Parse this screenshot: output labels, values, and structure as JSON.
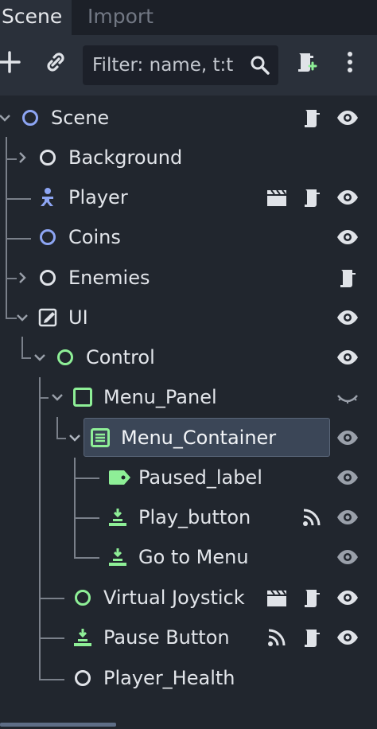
{
  "tabs": {
    "scene": "Scene",
    "import": "Import"
  },
  "toolbar": {
    "filter_placeholder": "Filter: name, t:type, g:group",
    "filter_display": "Filter: name, t:t"
  },
  "colors": {
    "node2d": "#8da5f3",
    "control": "#8eef97",
    "neutral": "#e0e3e8",
    "selection": "#3b4657",
    "background": "#21262e"
  },
  "tree": [
    {
      "label": "Scene",
      "icon": "node2d-circle-icon",
      "expanded": true,
      "script": true,
      "visible": true
    },
    {
      "label": "Background",
      "icon": "node-circle-icon",
      "expanded": false,
      "visible": null
    },
    {
      "label": "Player",
      "icon": "character-body-icon",
      "scene_instance": true,
      "script": true,
      "visible": true
    },
    {
      "label": "Coins",
      "icon": "node2d-circle-icon",
      "visible": true
    },
    {
      "label": "Enemies",
      "icon": "node-circle-icon",
      "expanded": false,
      "script": true,
      "visible": null
    },
    {
      "label": "UI",
      "icon": "canvas-layer-icon",
      "expanded": true,
      "visible": true
    },
    {
      "label": "Control",
      "icon": "control-circle-icon",
      "expanded": true,
      "visible": true
    },
    {
      "label": "Menu_Panel",
      "icon": "panel-icon",
      "expanded": true,
      "visible": false
    },
    {
      "label": "Menu_Container",
      "icon": "vbox-container-icon",
      "expanded": true,
      "selected": true,
      "visible": true
    },
    {
      "label": "Paused_label",
      "icon": "label-icon",
      "visible": true
    },
    {
      "label": "Play_button",
      "icon": "touch-button-icon",
      "signal": true,
      "visible": true
    },
    {
      "label": "Go to Menu",
      "icon": "touch-button-icon",
      "visible": true
    },
    {
      "label": "Virtual Joystick",
      "icon": "control-circle-icon",
      "scene_instance": true,
      "script": true,
      "visible": true
    },
    {
      "label": "Pause Button",
      "icon": "touch-button-icon",
      "signal": true,
      "script": true,
      "visible": true
    },
    {
      "label": "Player_Health",
      "icon": "node-circle-icon",
      "visible": null
    }
  ]
}
